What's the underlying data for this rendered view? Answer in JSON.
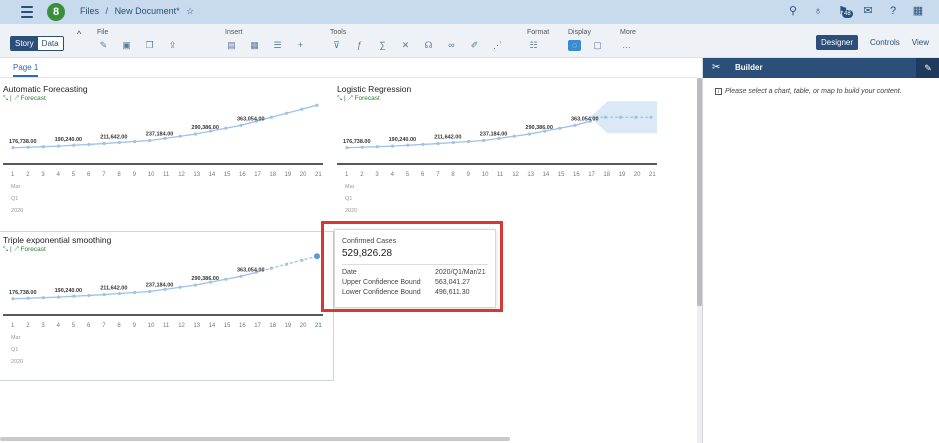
{
  "header": {
    "breadcrumb_files": "Files",
    "breadcrumb_sep": "/",
    "doc_title": "New Document*",
    "logo_letter": "8",
    "notification_count": "48"
  },
  "toolbar": {
    "story_label": "Story",
    "data_label": "Data",
    "groups": {
      "file": "File",
      "insert": "Insert",
      "tools": "Tools",
      "format": "Format",
      "display": "Display",
      "more": "More"
    },
    "designer_label": "Designer",
    "controls_label": "Controls",
    "view_label": "View"
  },
  "pages": {
    "active_tab": "Page 1"
  },
  "charts": [
    {
      "title": "Automatic Forecasting",
      "subtitle": "Forecast",
      "data_labels": [
        "176,738.00",
        "190,240.00",
        "211,642.00",
        "237,184.00",
        "290,386.00",
        "363,054.00"
      ],
      "x_ticks": [
        "1",
        "2",
        "3",
        "4",
        "5",
        "6",
        "7",
        "8",
        "9",
        "10",
        "11",
        "12",
        "13",
        "14",
        "15",
        "16",
        "17",
        "18",
        "19",
        "20",
        "21"
      ],
      "month": "Mar",
      "quarter": "Q1",
      "year": "2020"
    },
    {
      "title": "Logistic Regression",
      "subtitle": "Forecast",
      "data_labels": [
        "176,738.00",
        "190,240.00",
        "211,642.00",
        "237,184.00",
        "290,386.00",
        "363,054.00"
      ],
      "x_ticks": [
        "1",
        "2",
        "3",
        "4",
        "5",
        "6",
        "7",
        "8",
        "9",
        "10",
        "11",
        "12",
        "13",
        "14",
        "15",
        "16",
        "17",
        "18",
        "19",
        "20",
        "21"
      ],
      "month": "Mar",
      "quarter": "Q1",
      "year": "2020"
    },
    {
      "title": "Triple exponential smoothing",
      "subtitle": "Forecast",
      "data_labels": [
        "176,738.00",
        "190,240.00",
        "211,642.00",
        "237,184.00",
        "290,386.00",
        "363,054.00"
      ],
      "x_ticks": [
        "1",
        "2",
        "3",
        "4",
        "5",
        "6",
        "7",
        "8",
        "9",
        "10",
        "11",
        "12",
        "13",
        "14",
        "15",
        "16",
        "17",
        "18",
        "19",
        "20",
        "21"
      ],
      "month": "Mar",
      "quarter": "Q1",
      "year": "2020"
    }
  ],
  "chart_data": {
    "type": "line",
    "x": [
      1,
      2,
      3,
      4,
      5,
      6,
      7,
      8,
      9,
      10,
      11,
      12,
      13,
      14,
      15,
      16,
      17,
      18,
      19,
      20,
      21
    ],
    "labeled_points": [
      {
        "x": 1,
        "y": 176738.0
      },
      {
        "x": 4,
        "y": 190240.0
      },
      {
        "x": 7,
        "y": 211642.0
      },
      {
        "x": 10,
        "y": 237184.0
      },
      {
        "x": 13,
        "y": 290386.0
      },
      {
        "x": 16,
        "y": 363054.0
      }
    ],
    "actual_through_x": 17,
    "forecast_from_x": 18,
    "forecast_end_value": 529826.28
  },
  "tooltip": {
    "measure_label": "Confirmed Cases",
    "measure_value": "529,826.28",
    "date_label": "Date",
    "date_value": "2020/Q1/Mar/21",
    "upper_label": "Upper Confidence Bound",
    "upper_value": "563,041.27",
    "lower_label": "Lower Confidence Bound",
    "lower_value": "496,611.30"
  },
  "builder": {
    "title": "Builder",
    "message": "Please select a chart, table, or map to build your content."
  },
  "colors": {
    "shell_bar": "#c8dbee",
    "brand_dark": "#2b4f78",
    "line": "#9ec3e6",
    "highlight": "#d93636"
  }
}
